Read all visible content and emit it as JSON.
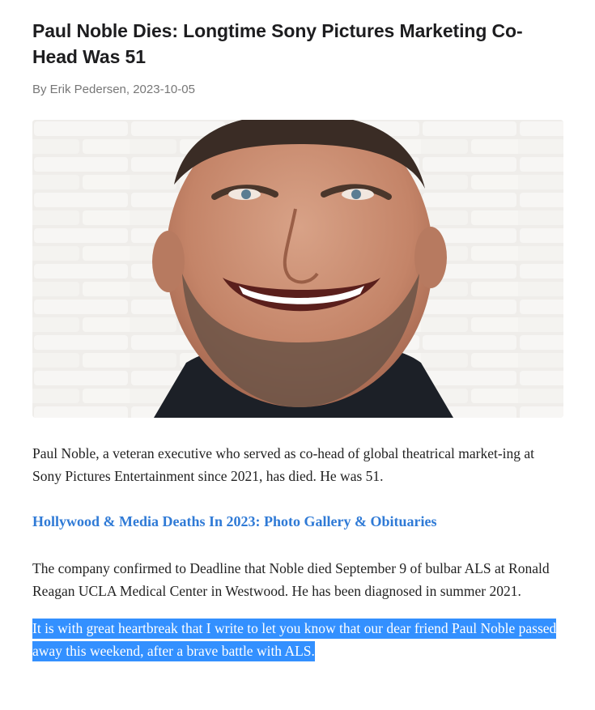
{
  "article": {
    "headline": "Paul Noble Dies: Longtime Sony Pictures Marketing Co-Head Was 51",
    "byline": "By Erik Pedersen, 2023-10-05",
    "photo": {
      "alt": "Paul Noble",
      "colors": {
        "wall": "#efedea",
        "skin": "#c98d72",
        "beard": "#6b5447",
        "shirt": "#1c2027"
      }
    },
    "paragraph_1": "Paul Noble, a veteran executive who served as co-head of global theatrical market-ing at Sony Pictures Entertainment since 2021, has died. He was 51.",
    "gallery_link": "Hollywood & Media Deaths In 2023: Photo Gallery & Obituaries",
    "paragraph_2": "The company confirmed to Deadline that Noble died September 9 of bulbar ALS at Ronald Reagan UCLA Medical Center in Westwood. He has been diagnosed in summer 2021.",
    "quote": "It is with great heartbreak that I write to let you know that our dear friend Paul Noble passed away this weekend, after a brave battle with ALS."
  },
  "colors": {
    "link": "#2f7ad6",
    "highlight": "#3390ff",
    "byline": "#777777"
  }
}
